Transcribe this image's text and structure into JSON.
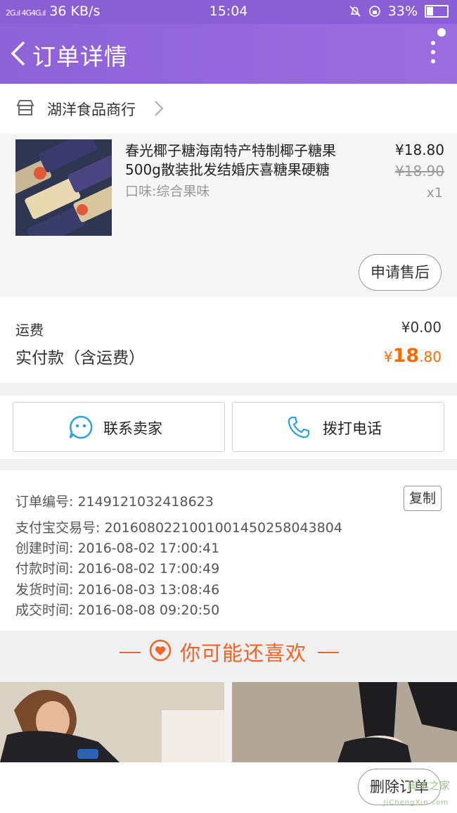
{
  "status_bar": {
    "network": "36 KB/s",
    "time": "15:04",
    "battery": "33%"
  },
  "header": {
    "title": "订单详情"
  },
  "shop": {
    "name": "湖洋食品商行"
  },
  "product": {
    "title": "春光椰子糖海南特产特制椰子糖果500g散装批发结婚庆喜糖果硬糖",
    "attribute": "口味:综合果味",
    "price": "¥18.80",
    "original_price": "¥18.90",
    "quantity": "x1",
    "after_sale_label": "申请售后"
  },
  "fees": {
    "shipping_label": "运费",
    "shipping_value": "¥0.00",
    "paid_label": "实付款（含运费）",
    "paid_currency": "¥",
    "paid_int": "18",
    "paid_dec": ".80"
  },
  "contact": {
    "seller_label": "联系卖家",
    "phone_label": "拨打电话"
  },
  "order_info": {
    "order_no": "订单编号: 2149121032418623",
    "copy_label": "复制",
    "alipay_no": "支付宝交易号: 2016080221001001450258043804",
    "created": "创建时间: 2016-08-02 17:00:41",
    "paid": "付款时间: 2016-08-02 17:00:49",
    "shipped": "发货时间: 2016-08-03 13:08:46",
    "completed": "成交时间: 2016-08-08 09:20:50"
  },
  "recommend": {
    "title": "你可能还喜欢"
  },
  "bottom": {
    "delete_label": "删除订单"
  },
  "watermark": {
    "text": "脚本之家",
    "url": "JiChengXin.com"
  },
  "colors": {
    "header": "#8e63d8",
    "accent": "#ff6a00",
    "recommend": "#f06428",
    "icon_blue": "#2aa0e6"
  }
}
